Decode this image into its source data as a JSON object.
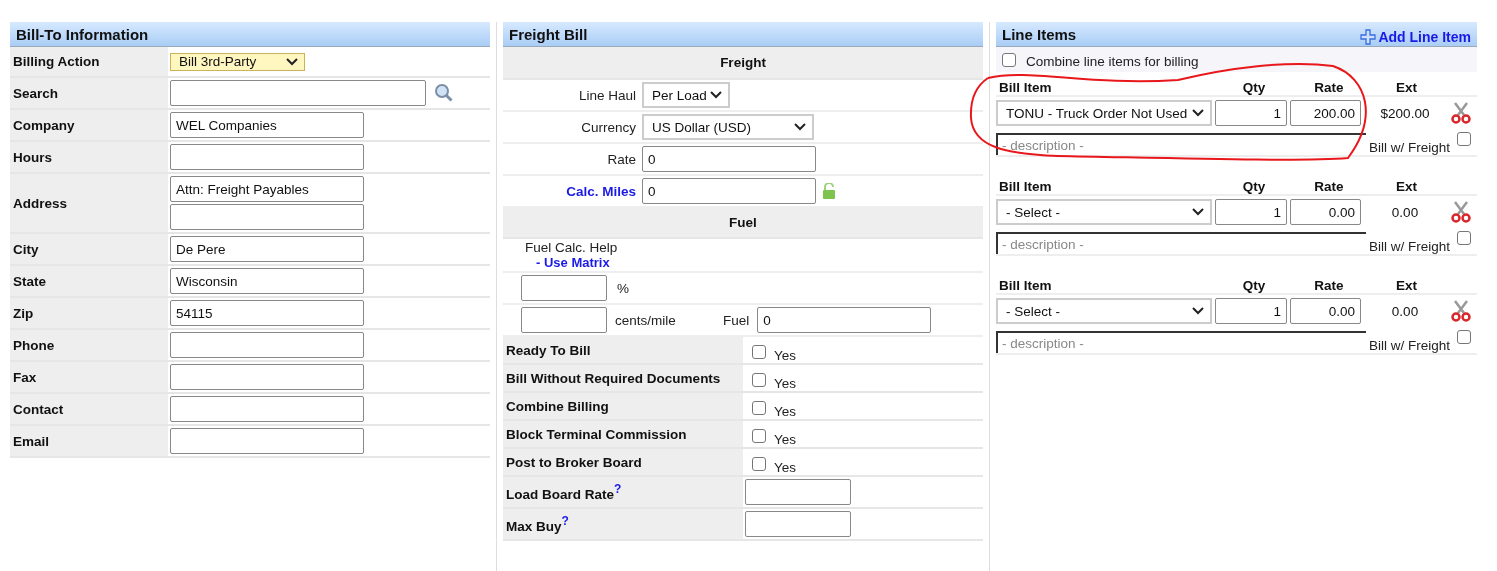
{
  "bill_to": {
    "title": "Bill-To Information",
    "fields": [
      {
        "kind": "select",
        "label": "Billing Action",
        "value": "Bill 3rd-Party"
      },
      {
        "kind": "search",
        "label": "Search"
      },
      {
        "kind": "text",
        "label": "Company",
        "value": "WEL Companies"
      },
      {
        "kind": "text",
        "label": "Hours"
      },
      {
        "kind": "address",
        "label": "Address",
        "value": "Attn: Freight Payables"
      },
      {
        "kind": "text",
        "label": "City",
        "value": "De Pere"
      },
      {
        "kind": "text",
        "label": "State",
        "value": "Wisconsin"
      },
      {
        "kind": "text",
        "label": "Zip",
        "value": "54115"
      },
      {
        "kind": "text",
        "label": "Phone"
      },
      {
        "kind": "text",
        "label": "Fax"
      },
      {
        "kind": "text",
        "label": "Contact"
      },
      {
        "kind": "text",
        "label": "Email"
      }
    ]
  },
  "freight_bill": {
    "title": "Freight Bill",
    "freight": {
      "heading": "Freight",
      "rows": [
        {
          "kind": "select",
          "label": "Line Haul",
          "value": "Per Load"
        },
        {
          "kind": "select",
          "label": "Currency",
          "value": "US Dollar (USD)"
        },
        {
          "kind": "text",
          "label": "Rate",
          "value": "0"
        },
        {
          "kind": "locked",
          "label": "Calc. Miles",
          "value": "0"
        }
      ]
    },
    "fuel": {
      "heading": "Fuel",
      "help_label": "Fuel Calc. Help",
      "help_link": "- Use Matrix",
      "percent_unit": "%",
      "cents_unit": "cents/mile",
      "fuel_label": "Fuel",
      "fuel_value": "0"
    },
    "options": [
      {
        "label": "Ready To Bill",
        "checked": false,
        "option": "Yes"
      },
      {
        "label": "Bill Without Required Documents",
        "checked": false,
        "option": "Yes"
      },
      {
        "label": "Combine Billing",
        "checked": false,
        "option": "Yes"
      },
      {
        "label": "Block Terminal Commission",
        "checked": false,
        "option": "Yes"
      },
      {
        "label": "Post to Broker Board",
        "checked": false,
        "option": "Yes"
      }
    ],
    "amounts": [
      {
        "label": "Load Board Rate",
        "help": "?"
      },
      {
        "label": "Max Buy",
        "help": "?"
      }
    ]
  },
  "line_items": {
    "title": "Line Items",
    "add_label": "Add Line Item",
    "combine": {
      "label": "Combine line items for billing",
      "checked": false
    },
    "items": [
      {
        "columns": [
          "Bill Item",
          "Qty",
          "Rate",
          "Ext"
        ],
        "item": "TONU - Truck Order Not Used",
        "qty": "1",
        "rate": "200.00",
        "ext": "$200.00",
        "description_placeholder": "- description -",
        "freight_label": "Bill w/ Freight",
        "bill_with_freight": false
      },
      {
        "columns": [
          "Bill Item",
          "Qty",
          "Rate",
          "Ext"
        ],
        "item": "- Select -",
        "qty": "1",
        "rate": "0.00",
        "ext": "0.00",
        "description_placeholder": "- description -",
        "freight_label": "Bill w/ Freight",
        "bill_with_freight": false
      },
      {
        "columns": [
          "Bill Item",
          "Qty",
          "Rate",
          "Ext"
        ],
        "item": "- Select -",
        "qty": "1",
        "rate": "0.00",
        "ext": "0.00",
        "description_placeholder": "- description -",
        "freight_label": "Bill w/ Freight",
        "bill_with_freight": false
      }
    ]
  }
}
